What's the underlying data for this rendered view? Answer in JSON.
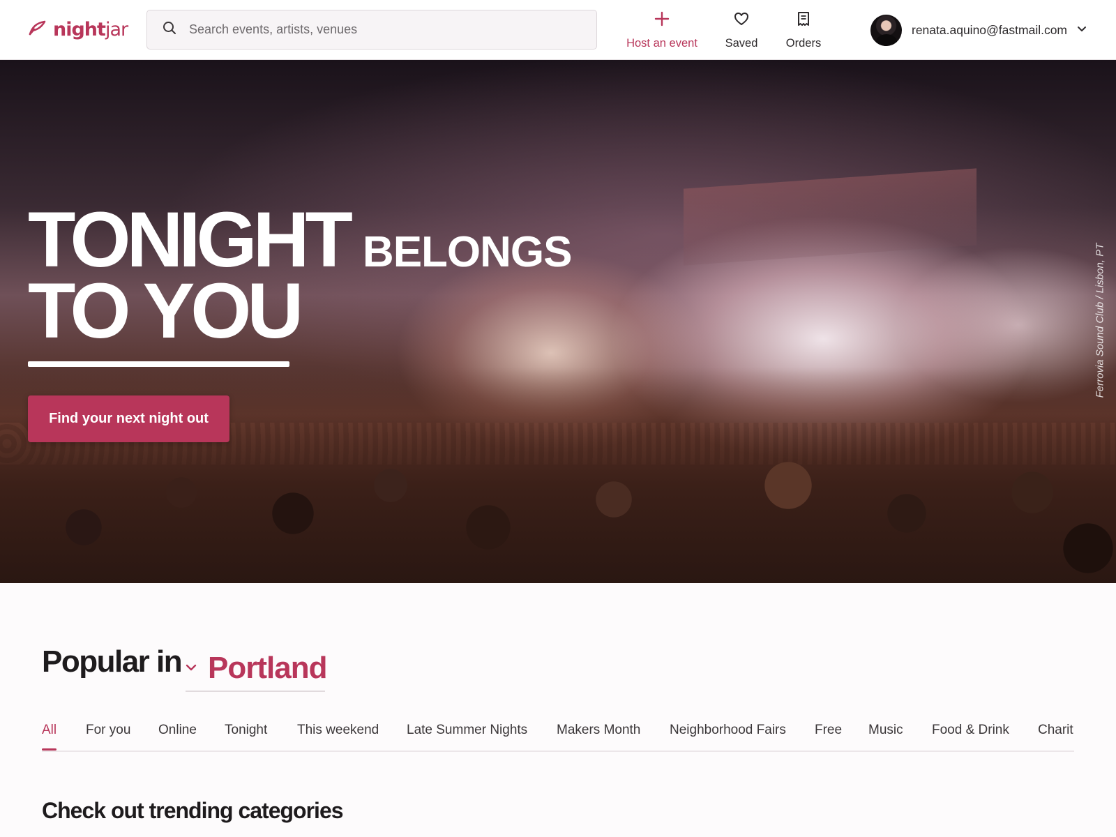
{
  "brand": {
    "name_bold": "night",
    "name_light": "jar",
    "accent_color": "#b8365a",
    "logo_icon": "feather-icon"
  },
  "search": {
    "placeholder": "Search events, artists, venues",
    "icon": "search-icon"
  },
  "nav": {
    "host_label": "Host an event",
    "saved_label": "Saved",
    "orders_label": "Orders"
  },
  "account": {
    "email": "renata.aquino@fastmail.com"
  },
  "hero": {
    "line1_big": "TONIGHT",
    "line1_small": "BELONGS",
    "line2": "TO YOU",
    "cta_label": "Find your next night out",
    "photo_credit": "Ferrovia Sound Club / Lisbon, PT"
  },
  "popular": {
    "heading": "Popular in",
    "city": "Portland",
    "tabs": [
      {
        "label": "All",
        "active": true
      },
      {
        "label": "For you",
        "active": false
      },
      {
        "label": "Online",
        "active": false
      },
      {
        "label": "Tonight",
        "active": false
      },
      {
        "label": "This weekend",
        "active": false
      },
      {
        "label": "Late Summer Nights",
        "active": false
      },
      {
        "label": "Makers Month",
        "active": false
      },
      {
        "label": "Neighborhood Fairs",
        "active": false
      },
      {
        "label": "Free",
        "active": false
      },
      {
        "label": "Music",
        "active": false
      },
      {
        "label": "Food & Drink",
        "active": false
      },
      {
        "label": "Charit",
        "active": false
      }
    ]
  },
  "trending": {
    "heading": "Check out trending categories"
  }
}
